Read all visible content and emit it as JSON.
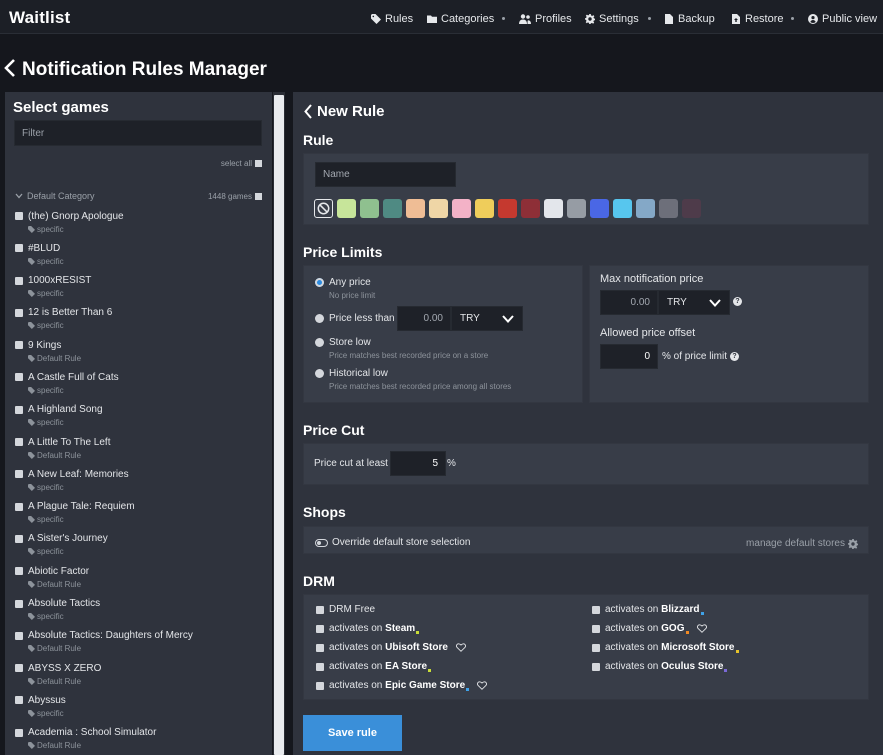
{
  "nav": {
    "brand": "Waitlist",
    "items": [
      {
        "label": "Rules",
        "icon": "tag-icon"
      },
      {
        "label": "Categories",
        "icon": "folder-icon"
      },
      {
        "label": "Profiles",
        "icon": "users-icon"
      },
      {
        "label": "Settings",
        "icon": "gear-icon"
      },
      {
        "label": "Backup",
        "icon": "backup-icon"
      },
      {
        "label": "Restore",
        "icon": "restore-icon"
      },
      {
        "label": "Public view",
        "icon": "user-circle-icon"
      }
    ]
  },
  "page": {
    "title": "Notification Rules Manager"
  },
  "left": {
    "title": "Select games",
    "filter_placeholder": "Filter",
    "select_all": "select all",
    "category": {
      "name": "Default Category",
      "count": "1448 games"
    },
    "games": [
      {
        "name": "(the) Gnorp Apologue",
        "rule": "specific"
      },
      {
        "name": "#BLUD",
        "rule": "specific"
      },
      {
        "name": "1000xRESIST",
        "rule": "specific"
      },
      {
        "name": "12 is Better Than 6",
        "rule": "specific"
      },
      {
        "name": "9 Kings",
        "rule": "Default Rule"
      },
      {
        "name": "A Castle Full of Cats",
        "rule": "specific"
      },
      {
        "name": "A Highland Song",
        "rule": "specific"
      },
      {
        "name": "A Little To The Left",
        "rule": "Default Rule"
      },
      {
        "name": "A New Leaf: Memories",
        "rule": "specific"
      },
      {
        "name": "A Plague Tale: Requiem",
        "rule": "specific"
      },
      {
        "name": "A Sister's Journey",
        "rule": "specific"
      },
      {
        "name": "Abiotic Factor",
        "rule": "Default Rule"
      },
      {
        "name": "Absolute Tactics",
        "rule": "specific"
      },
      {
        "name": "Absolute Tactics: Daughters of Mercy",
        "rule": "Default Rule"
      },
      {
        "name": "ABYSS X ZERO",
        "rule": "Default Rule"
      },
      {
        "name": "Abyssus",
        "rule": "specific"
      },
      {
        "name": "Academia : School Simulator",
        "rule": "Default Rule"
      }
    ]
  },
  "rule": {
    "back_title": "New Rule",
    "section_rule": "Rule",
    "name_placeholder": "Name",
    "colors": [
      "#c7e59a",
      "#8fc08f",
      "#4f8a83",
      "#efbd95",
      "#efd6a6",
      "#f3b2c7",
      "#efcd5b",
      "#c5392f",
      "#8e2f37",
      "#e3e6eb",
      "#969ca4",
      "#4a67e5",
      "#57c6ee",
      "#84a8c7",
      "#6d6f7a",
      "#4e3b4a"
    ],
    "section_price_limits": "Price Limits",
    "options": {
      "any_price": "Any price",
      "any_price_sub": "No price limit",
      "price_less_than": "Price less than",
      "price_less_value": "0.00",
      "store_low": "Store low",
      "store_low_sub": "Price matches best recorded price on a store",
      "historical_low": "Historical low",
      "historical_low_sub": "Price matches best recorded price among all stores"
    },
    "currency": "TRY",
    "max_notification_price": "Max notification price",
    "max_price_value": "0.00",
    "allowed_offset": "Allowed price offset",
    "offset_value": "0",
    "offset_suffix": "% of price limit",
    "section_price_cut": "Price Cut",
    "price_cut_label": "Price cut at least",
    "price_cut_value": "5",
    "price_cut_unit": "%",
    "section_shops": "Shops",
    "override_label": "Override default store selection",
    "manage_stores": "manage default stores",
    "section_drm": "DRM",
    "drm_free": "DRM Free",
    "activates_on": "activates on",
    "stores_left": [
      {
        "name": "Steam",
        "dot": "#c9dd38",
        "heart": false
      },
      {
        "name": "Ubisoft Store",
        "dot": "",
        "heart": true
      },
      {
        "name": "EA Store",
        "dot": "#c9dd38",
        "heart": false
      },
      {
        "name": "Epic Game Store",
        "dot": "#3fa2e8",
        "heart": true
      }
    ],
    "stores_right": [
      {
        "name": "Blizzard",
        "dot": "#3fa2e8",
        "heart": false
      },
      {
        "name": "GOG",
        "dot": "#f08a24",
        "heart": true
      },
      {
        "name": "Microsoft Store",
        "dot": "#e6c32b",
        "heart": false
      },
      {
        "name": "Oculus Store",
        "dot": "#7a69d6",
        "heart": false
      }
    ],
    "save_label": "Save rule"
  }
}
